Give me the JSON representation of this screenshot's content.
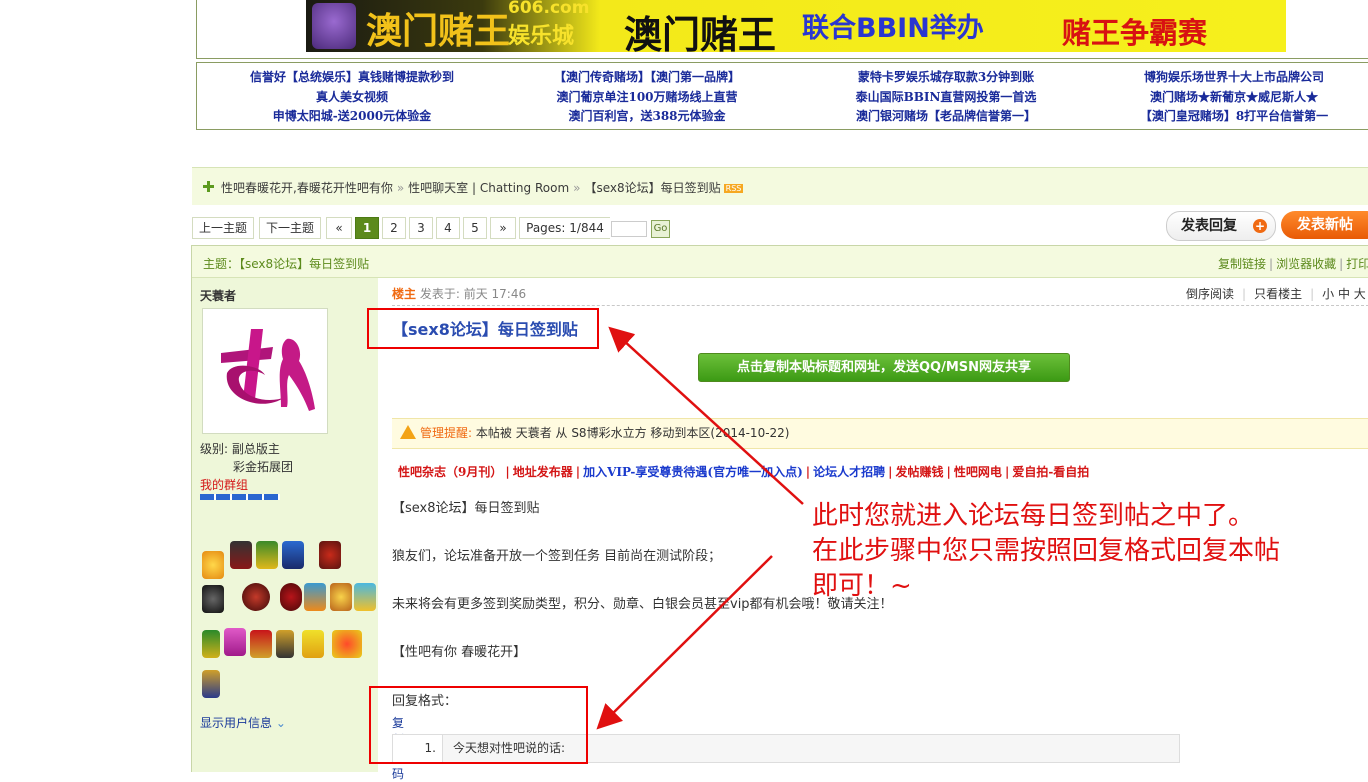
{
  "banner": {
    "domain": "606.com",
    "brand_cn": "娱乐城",
    "brand_big": "澳门赌王",
    "tagline_main": "澳门赌王",
    "tagline_mid": "联合BBIN举办",
    "tagline_end": "赌王争霸赛"
  },
  "ads": {
    "columns": [
      [
        "信誉好【总统娱乐】真钱赌博提款秒到",
        "真人美女视频",
        "申博太阳城-送2000元体验金"
      ],
      [
        "【澳门传奇赌场】【澳门第一品牌】",
        "澳门葡京单注100万赌场线上直营",
        "澳门百利宫，送388元体验金"
      ],
      [
        "蒙特卡罗娱乐城存取款3分钟到账",
        "泰山国际BBIN直营网投第一首选",
        "澳门银河赌场【老品牌信誉第一】"
      ],
      [
        "博狗娱乐场世界十大上市品牌公司",
        "澳门赌场★新葡京★威尼斯人★",
        "【澳门皇冠赌场】8打平台信誉第一"
      ]
    ]
  },
  "breadcrumb": {
    "home": "性吧春暖花开,春暖花开性吧有你",
    "sep": "»",
    "forum": "性吧聊天室 | Chatting Room",
    "thread": "【sex8论坛】每日签到贴",
    "rss": "RSS"
  },
  "pager": {
    "prev": "上一主题",
    "next": "下一主题",
    "first": "«",
    "pages": [
      "1",
      "2",
      "3",
      "4",
      "5"
    ],
    "last": "»",
    "pages_label": "Pages: 1/844",
    "go": "Go"
  },
  "actions": {
    "reply": "发表回复",
    "reply_icon": "+",
    "new_post": "发表新帖"
  },
  "subject_bar": {
    "subject": "主题：【sex8论坛】每日签到贴",
    "tools": [
      "复制链接",
      "浏览器收藏",
      "打印"
    ],
    "tool_sep": "|"
  },
  "author": {
    "name": "天蓑者",
    "level_label": "级别: 副总版主",
    "level_sub": "彩金拓展团",
    "my_group": "我的群组",
    "show_info": "显示用户信息"
  },
  "post": {
    "floor": "楼主",
    "posted_at": "发表于: 前天 17:46",
    "view_tools": [
      "倒序阅读",
      "只看楼主",
      "小 中 大"
    ],
    "title": "【sex8论坛】每日签到贴",
    "copy_button": "点击复制本贴标题和网址，发送QQ/MSN网友共享",
    "notice_label": "管理提醒:",
    "notice_text": "本帖被 天蓑者 从 S8博彩水立方 移动到本区(2014-10-22)",
    "links": [
      "性吧杂志（9月刊）",
      "地址发布器",
      "加入VIP-享受尊贵待遇(官方唯一加入点)",
      "论坛人才招聘",
      "发帖赚钱",
      "性吧网电",
      "爱自拍-看自拍"
    ],
    "link_sep": "|",
    "body": [
      "【sex8论坛】每日签到贴",
      "狼友们，论坛准备开放一个签到任务 目前尚在测试阶段；",
      "未来将会有更多签到奖励类型，积分、勋章、白银会员甚至vip都有机会哦！敬请关注！",
      "【性吧有你 春暖花开】",
      "回复格式："
    ],
    "copy_code": "复制代码",
    "code_line_num": "1.",
    "code_line": "今天想对性吧说的话:"
  },
  "annotation": {
    "lines": [
      "此时您就进入论坛每日签到帖之中了。",
      "在此步骤中您只需按照回复格式回复本帖",
      "即可！~"
    ],
    "color": "#e01010"
  }
}
